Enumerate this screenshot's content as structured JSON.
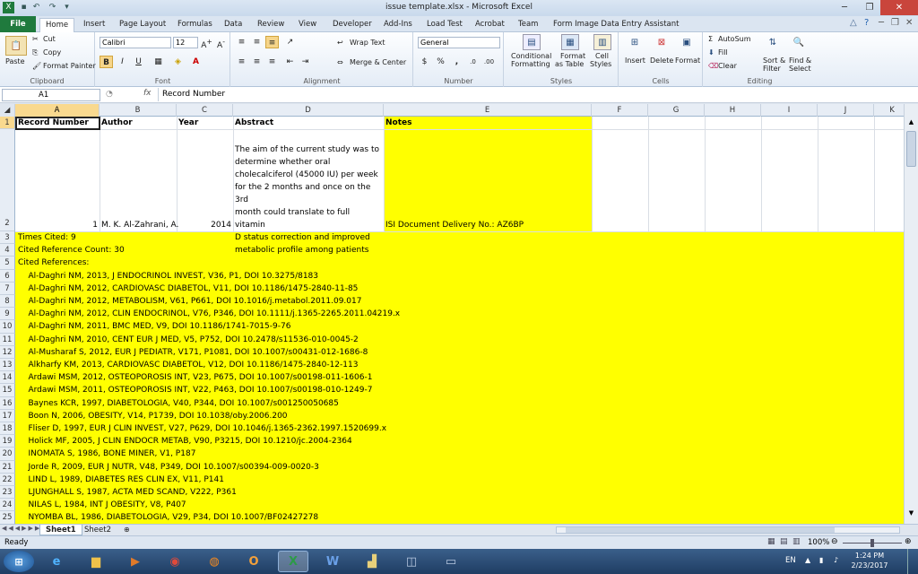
{
  "window": {
    "title": "issue template.xlsx - Microsoft Excel"
  },
  "tabs": [
    "File",
    "Home",
    "Insert",
    "Page Layout",
    "Formulas",
    "Data",
    "Review",
    "View",
    "Developer",
    "Add-Ins",
    "Load Test",
    "Acrobat",
    "Team",
    "Form Image Data Entry Assistant"
  ],
  "ribbon": {
    "clipboard": {
      "label": "Clipboard",
      "paste": "Paste",
      "cut": "Cut",
      "copy": "Copy",
      "format_painter": "Format Painter"
    },
    "font": {
      "label": "Font",
      "family": "Calibri",
      "size": "12"
    },
    "alignment": {
      "label": "Alignment",
      "wrap": "Wrap Text",
      "merge": "Merge & Center"
    },
    "number": {
      "label": "Number",
      "format": "General"
    },
    "styles": {
      "label": "Styles",
      "cond1": "Conditional",
      "cond2": "Formatting",
      "fmt1": "Format",
      "fmt2": "as Table",
      "cell1": "Cell",
      "cell2": "Styles"
    },
    "cells": {
      "label": "Cells",
      "insert": "Insert",
      "delete": "Delete",
      "format": "Format"
    },
    "editing": {
      "label": "Editing",
      "autosum": "AutoSum",
      "fill": "Fill",
      "clear": "Clear",
      "sort1": "Sort &",
      "sort2": "Filter",
      "find1": "Find &",
      "find2": "Select"
    }
  },
  "formula_bar": {
    "name_box": "A1",
    "fx": "fx",
    "value": "Record Number"
  },
  "columns": [
    "A",
    "B",
    "C",
    "D",
    "E",
    "F",
    "G",
    "H",
    "I",
    "J",
    "K"
  ],
  "header_row": {
    "a": "Record Number",
    "b": "Author",
    "c": "Year",
    "d": "Abstract",
    "e": "Notes"
  },
  "row2": {
    "a": "1",
    "b": "M. K. Al-Zahrani, A.",
    "c": "2014",
    "d_lines": [
      "The aim of the current study was to",
      "determine whether oral",
      "cholecalciferol (45000 IU) per week",
      "for the 2 months and once on the 3rd",
      "month could translate to full vitamin",
      "D status correction and improved",
      "metabolic profile among patients"
    ],
    "e": "ISI Document Delivery No.: AZ6BP"
  },
  "rows": [
    {
      "n": "3",
      "text": "Times Cited: 9"
    },
    {
      "n": "4",
      "text": "Cited Reference Count: 30"
    },
    {
      "n": "5",
      "text": "Cited References:"
    },
    {
      "n": "6",
      "text": "    Al-Daghri NM, 2013, J ENDOCRINOL INVEST, V36, P1, DOI 10.3275/8183"
    },
    {
      "n": "7",
      "text": "    Al-Daghri NM, 2012, CARDIOVASC DIABETOL, V11, DOI 10.1186/1475-2840-11-85"
    },
    {
      "n": "8",
      "text": "    Al-Daghri NM, 2012, METABOLISM, V61, P661, DOI 10.1016/j.metabol.2011.09.017"
    },
    {
      "n": "9",
      "text": "    Al-Daghri NM, 2012, CLIN ENDOCRINOL, V76, P346, DOI 10.1111/j.1365-2265.2011.04219.x"
    },
    {
      "n": "10",
      "text": "    Al-Daghri NM, 2011, BMC MED, V9, DOI 10.1186/1741-7015-9-76"
    },
    {
      "n": "11",
      "text": "    Al-Daghri NM, 2010, CENT EUR J MED, V5, P752, DOI 10.2478/s11536-010-0045-2"
    },
    {
      "n": "12",
      "text": "    Al-Musharaf S, 2012, EUR J PEDIATR, V171, P1081, DOI 10.1007/s00431-012-1686-8"
    },
    {
      "n": "13",
      "text": "    Alkharfy KM, 2013, CARDIOVASC DIABETOL, V12, DOI 10.1186/1475-2840-12-113"
    },
    {
      "n": "14",
      "text": "    Ardawi MSM, 2012, OSTEOPOROSIS INT, V23, P675, DOI 10.1007/s00198-011-1606-1"
    },
    {
      "n": "15",
      "text": "    Ardawi MSM, 2011, OSTEOPOROSIS INT, V22, P463, DOI 10.1007/s00198-010-1249-7"
    },
    {
      "n": "16",
      "text": "    Baynes KCR, 1997, DIABETOLOGIA, V40, P344, DOI 10.1007/s001250050685"
    },
    {
      "n": "17",
      "text": "    Boon N, 2006, OBESITY, V14, P1739, DOI 10.1038/oby.2006.200"
    },
    {
      "n": "18",
      "text": "    Fliser D, 1997, EUR J CLIN INVEST, V27, P629, DOI 10.1046/j.1365-2362.1997.1520699.x"
    },
    {
      "n": "19",
      "text": "    Holick MF, 2005, J CLIN ENDOCR METAB, V90, P3215, DOI 10.1210/jc.2004-2364"
    },
    {
      "n": "20",
      "text": "    INOMATA S, 1986, BONE MINER, V1, P187"
    },
    {
      "n": "21",
      "text": "    Jorde R, 2009, EUR J NUTR, V48, P349, DOI 10.1007/s00394-009-0020-3"
    },
    {
      "n": "22",
      "text": "    LIND L, 1989, DIABETES RES CLIN EX, V11, P141"
    },
    {
      "n": "23",
      "text": "    LJUNGHALL S, 1987, ACTA MED SCAND, V222, P361"
    },
    {
      "n": "24",
      "text": "    NILAS L, 1984, INT J OBESITY, V8, P407"
    },
    {
      "n": "25",
      "text": "    NYOMBA BL, 1986, DIABETOLOGIA, V29, P34, DOI 10.1007/BF02427278"
    }
  ],
  "sheets": [
    "Sheet1",
    "Sheet2"
  ],
  "status": {
    "ready": "Ready",
    "zoom": "100%"
  },
  "taskbar": {
    "lang": "EN",
    "time": "1:24 PM",
    "date": "2/23/2017"
  },
  "colors": {
    "highlight": "#ffff00",
    "excel_green": "#1f7a3d"
  }
}
